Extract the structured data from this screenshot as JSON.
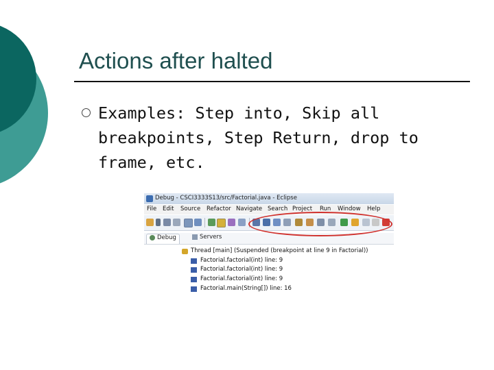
{
  "slide": {
    "title": "Actions after halted",
    "bullets": [
      "Examples: Step into, Skip all breakpoints, Step Return, drop to frame, etc."
    ]
  },
  "screenshot": {
    "window_title": "Debug - CSCI3333S13/src/Factorial.java - Eclipse",
    "menu": [
      "File",
      "Edit",
      "Source",
      "Refactor",
      "Navigate",
      "Search",
      "Project",
      "Run",
      "Window",
      "Help"
    ],
    "tabs": [
      {
        "label": "Debug",
        "icon": "debug-bug-icon",
        "active": true
      },
      {
        "label": "Servers",
        "icon": "servers-icon",
        "active": false
      }
    ],
    "tree": [
      {
        "label": "Thread [main] (Suspended (breakpoint at line 9 in Factorial))",
        "icon": "thread-icon",
        "indent": 1
      },
      {
        "label": "Factorial.factorial(int) line: 9",
        "icon": "stack-frame-icon",
        "indent": 2
      },
      {
        "label": "Factorial.factorial(int) line: 9",
        "icon": "stack-frame-icon",
        "indent": 2
      },
      {
        "label": "Factorial.factorial(int) line: 9",
        "icon": "stack-frame-icon",
        "indent": 2
      },
      {
        "label": "Factorial.main(String[]) line: 16",
        "icon": "stack-frame-icon",
        "indent": 2
      }
    ]
  },
  "colors": {
    "deco_dark": "#0b6660",
    "deco_light": "#3e9c94",
    "highlight_ellipse": "#d0312d",
    "title_text": "#1f4f4f"
  }
}
